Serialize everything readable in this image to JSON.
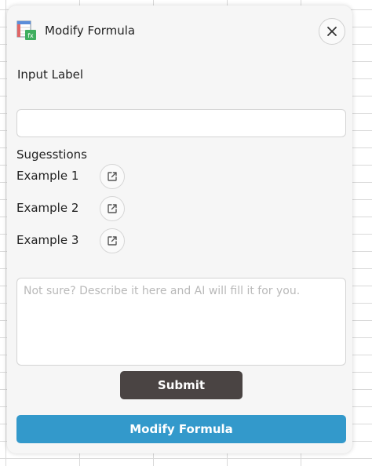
{
  "header": {
    "title": "Modify Formula",
    "app_icon": "spreadsheet-formula-icon",
    "close_icon": "close-icon"
  },
  "form": {
    "input_label": "Input Label",
    "input_value": "",
    "input_placeholder": ""
  },
  "suggestions": {
    "title": "Sugesstions",
    "open_icon": "open-external-icon",
    "items": [
      {
        "label": "Example 1"
      },
      {
        "label": "Example 2"
      },
      {
        "label": "Example 3"
      }
    ]
  },
  "describe": {
    "placeholder": "Not sure? Describe it here and AI will fill it for you.",
    "value": ""
  },
  "buttons": {
    "submit_label": "Submit",
    "primary_label": "Modify Formula"
  },
  "colors": {
    "panel_background": "#f6f6f6",
    "submit_button": "#4a4443",
    "primary_button": "#3399cb",
    "text": "#222222",
    "placeholder": "#b9b9b9"
  }
}
